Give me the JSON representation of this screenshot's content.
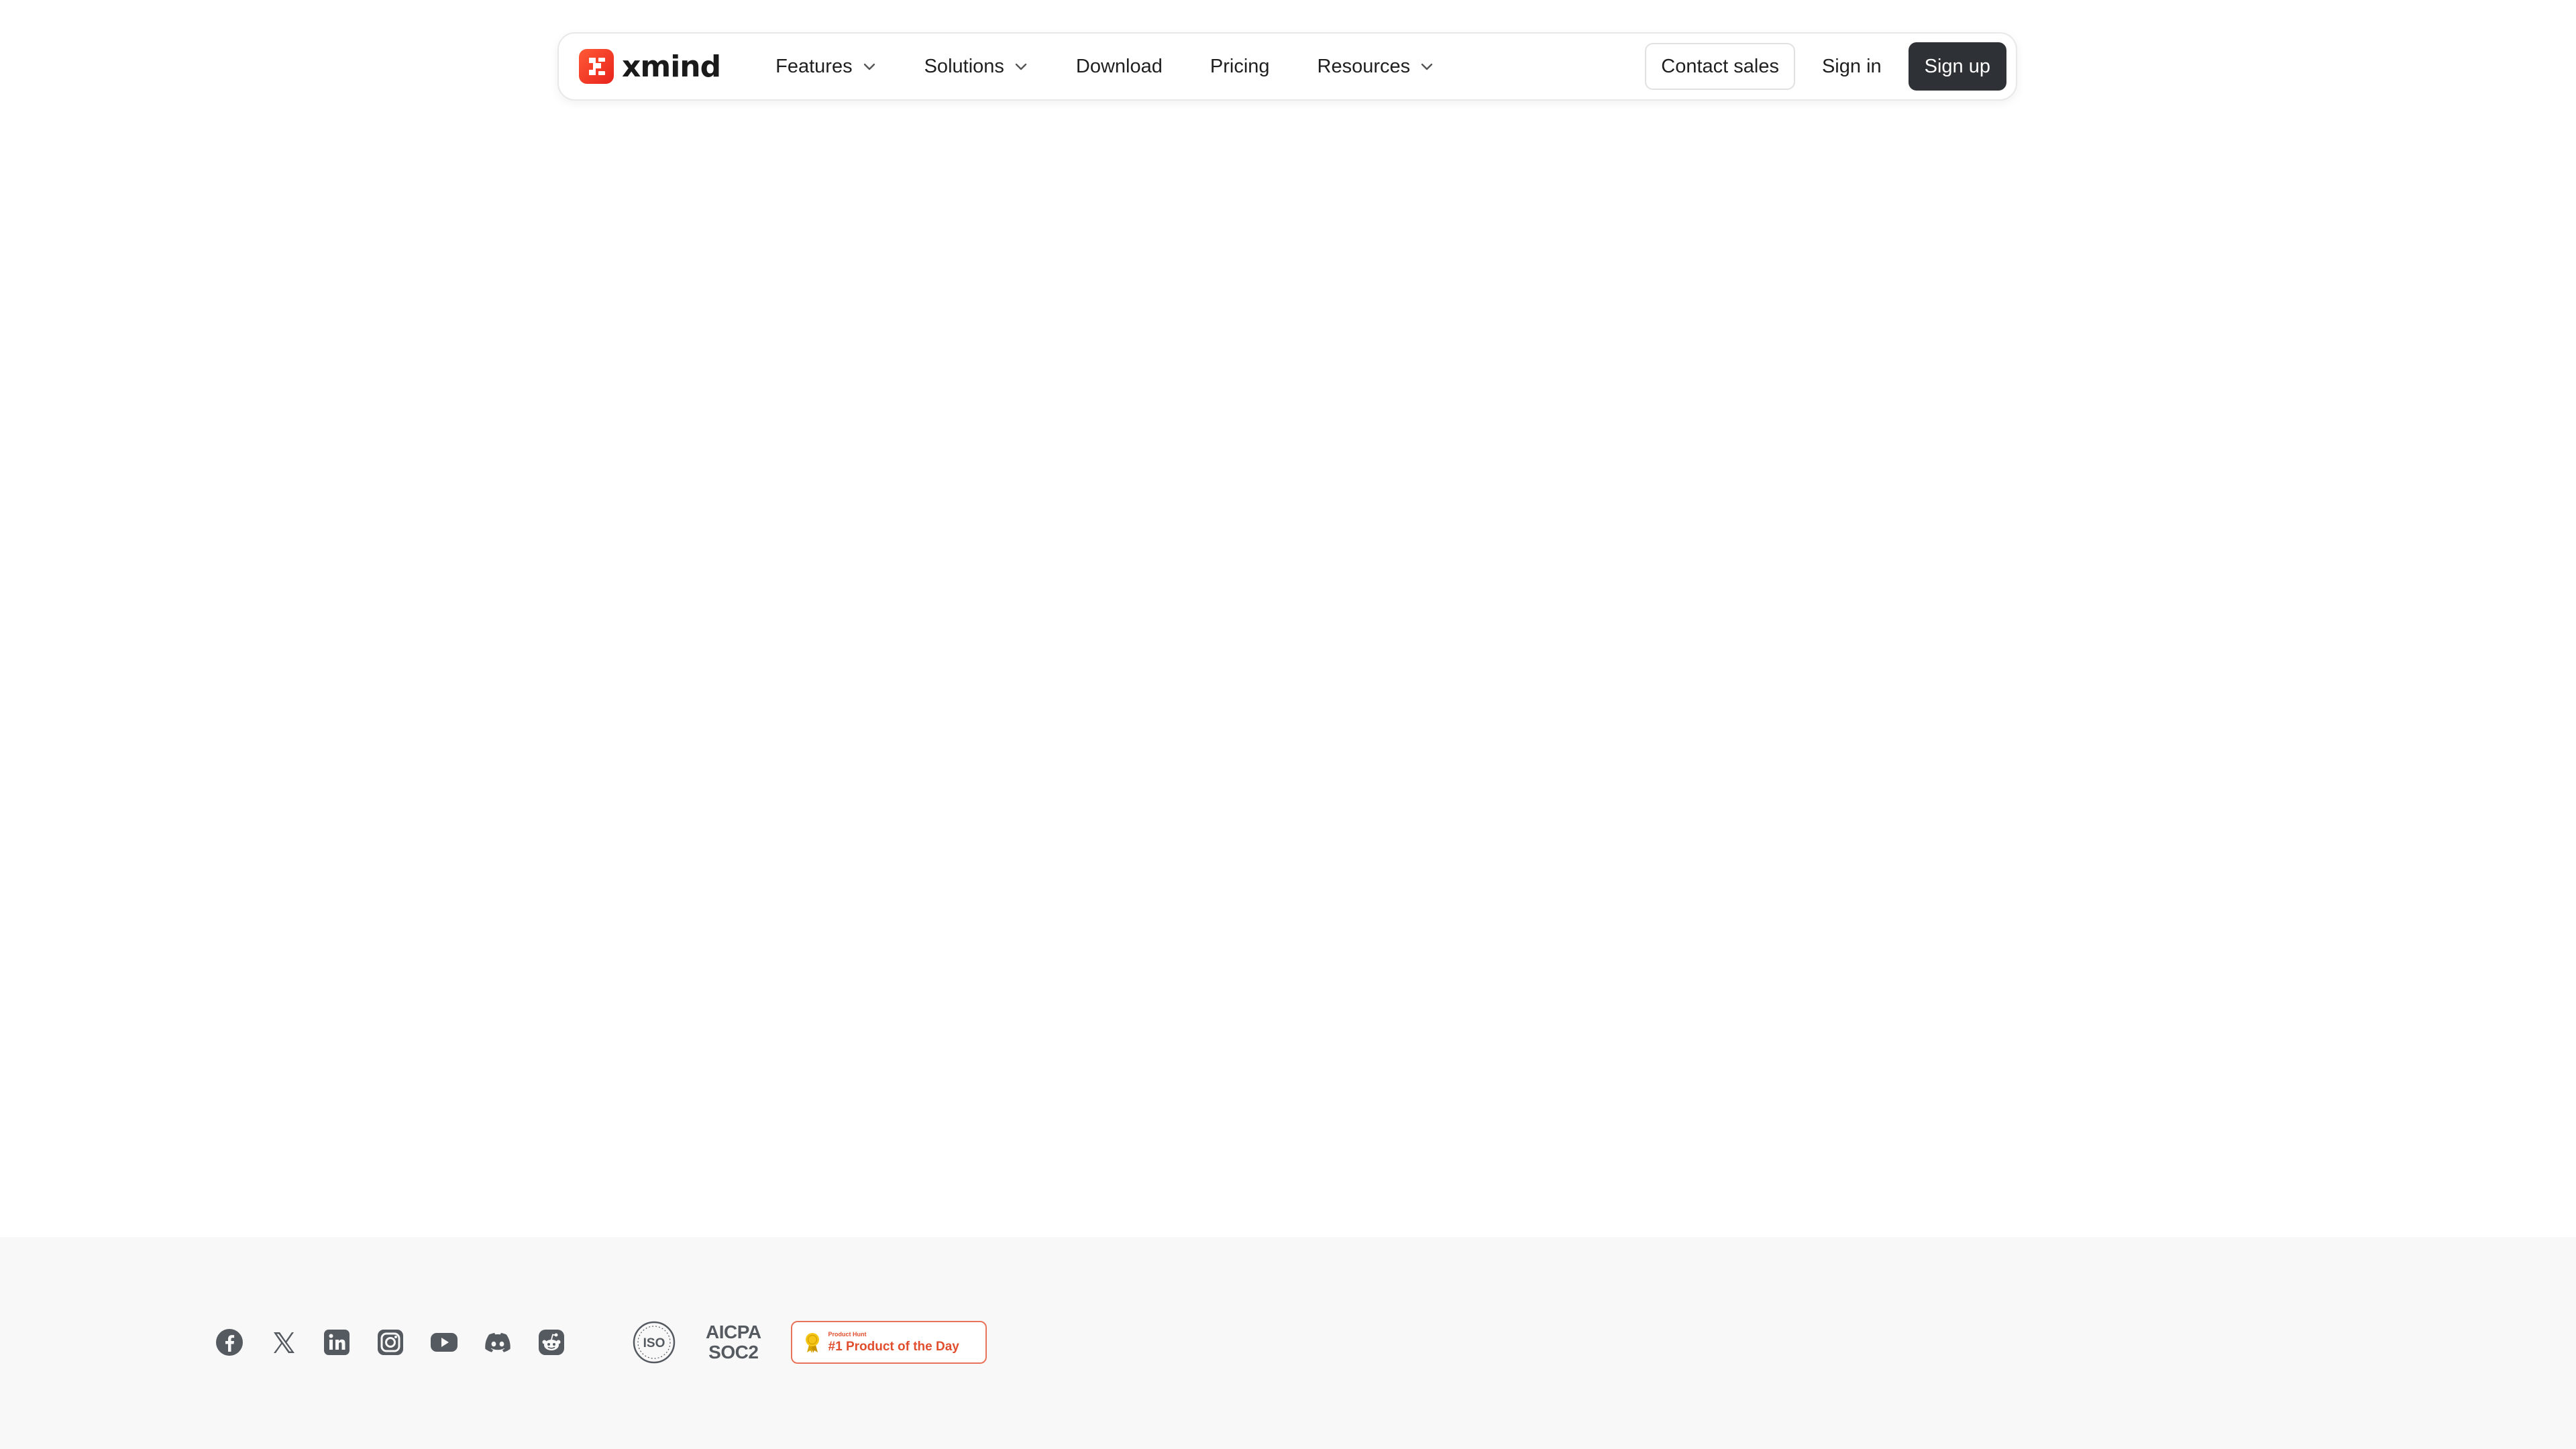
{
  "header": {
    "logo_text": "xmind",
    "nav": [
      {
        "label": "Features",
        "has_dropdown": true
      },
      {
        "label": "Solutions",
        "has_dropdown": true
      },
      {
        "label": "Download",
        "has_dropdown": false
      },
      {
        "label": "Pricing",
        "has_dropdown": false
      },
      {
        "label": "Resources",
        "has_dropdown": true
      }
    ],
    "contact_sales": "Contact sales",
    "sign_in": "Sign in",
    "sign_up": "Sign up"
  },
  "footer": {
    "social_icons": [
      "facebook-icon",
      "x-icon",
      "linkedin-icon",
      "instagram-icon",
      "youtube-icon",
      "discord-icon",
      "reddit-icon"
    ],
    "iso_label": "ISO",
    "soc": {
      "line1": "AICPA",
      "line2": "SOC2"
    },
    "product_hunt": {
      "top": "Product Hunt",
      "main": "#1 Product of the Day"
    }
  },
  "colors": {
    "brand_red": "#e8231c",
    "dark_button": "#2e3135",
    "footer_bg": "#f8f8f8",
    "icon_gray": "#555a60",
    "product_hunt": "#e04e2e"
  }
}
